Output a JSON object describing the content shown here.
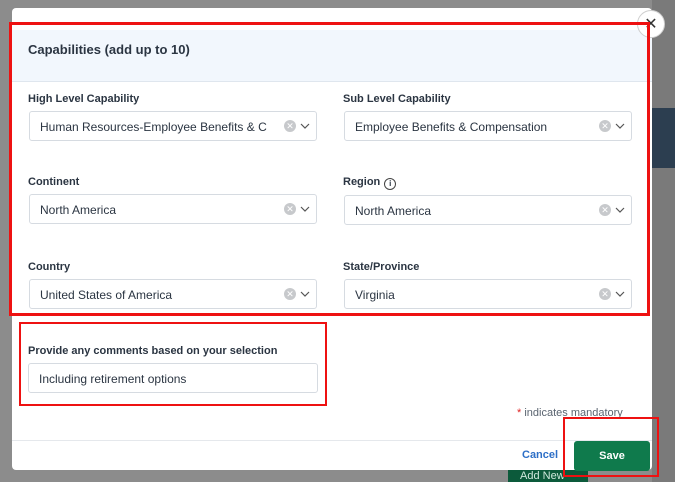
{
  "modal": {
    "title": "Capabilities (add up to 10)",
    "close_symbol": "✕"
  },
  "fields": {
    "high_level": {
      "label": "High Level Capability",
      "value": "Human Resources-Employee Benefits & C"
    },
    "sub_level": {
      "label": "Sub Level Capability",
      "value": "Employee Benefits & Compensation"
    },
    "continent": {
      "label": "Continent",
      "value": "North America"
    },
    "region": {
      "label": "Region",
      "value": "North America"
    },
    "country": {
      "label": "Country",
      "value": "United States of America"
    },
    "state": {
      "label": "State/Province",
      "value": "Virginia"
    }
  },
  "comments": {
    "label": "Provide any comments based on your selection",
    "value": "Including retirement options"
  },
  "footer": {
    "mandatory_star": "*",
    "mandatory_text": "indicates mandatory",
    "cancel_label": "Cancel",
    "save_label": "Save"
  },
  "background": {
    "add_new_label": "Add New"
  },
  "colors": {
    "highlight": "#ee1111",
    "save_button": "#0f7a4c",
    "header_bg": "#f2f7fd"
  }
}
